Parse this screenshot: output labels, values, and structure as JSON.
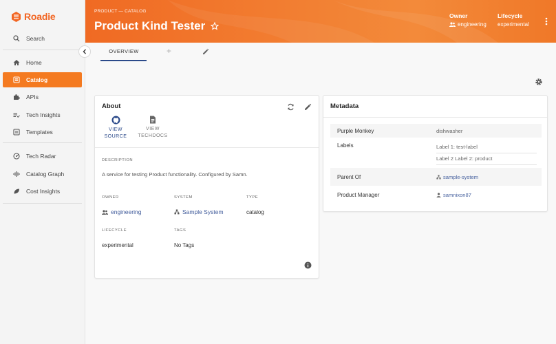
{
  "brand": {
    "name": "Roadie",
    "accent": "#f26522"
  },
  "sidebar": {
    "items": [
      {
        "label": "Search",
        "icon": "search-icon"
      },
      {
        "label": "Home",
        "icon": "home-icon"
      },
      {
        "label": "Catalog",
        "icon": "catalog-icon",
        "active": true
      },
      {
        "label": "APIs",
        "icon": "puzzle-icon"
      },
      {
        "label": "Tech Insights",
        "icon": "checklist-icon"
      },
      {
        "label": "Templates",
        "icon": "templates-icon"
      },
      {
        "label": "Tech Radar",
        "icon": "radar-icon"
      },
      {
        "label": "Catalog Graph",
        "icon": "graph-icon"
      },
      {
        "label": "Cost Insights",
        "icon": "leaf-icon"
      }
    ]
  },
  "header": {
    "breadcrumb": "PRODUCT — CATALOG",
    "title": "Product Kind Tester",
    "owner_label": "Owner",
    "owner_value": "engineering",
    "lifecycle_label": "Lifecycle",
    "lifecycle_value": "experimental"
  },
  "tabs": {
    "overview": "OVERVIEW",
    "add": "+"
  },
  "about": {
    "title": "About",
    "view_source": [
      "VIEW",
      "SOURCE"
    ],
    "view_techdocs": [
      "VIEW",
      "TECHDOCS"
    ],
    "description_label": "DESCRIPTION",
    "description": "A service for testing Product functionality. Configured by Samn.",
    "owner_label": "OWNER",
    "owner": "engineering",
    "system_label": "SYSTEM",
    "system": "Sample System",
    "type_label": "TYPE",
    "type": "catalog",
    "lifecycle_label": "LIFECYCLE",
    "lifecycle": "experimental",
    "tags_label": "TAGS",
    "tags": "No Tags"
  },
  "metadata": {
    "title": "Metadata",
    "rows": [
      {
        "key": "Purple Monkey",
        "value": "dishwasher"
      },
      {
        "key": "Labels",
        "values": [
          "Label 1: test-label",
          "Label 2 Label 2: product"
        ]
      },
      {
        "key": "Parent Of",
        "value": "sample-system"
      },
      {
        "key": "Product Manager",
        "value": "samnixon87"
      }
    ]
  }
}
